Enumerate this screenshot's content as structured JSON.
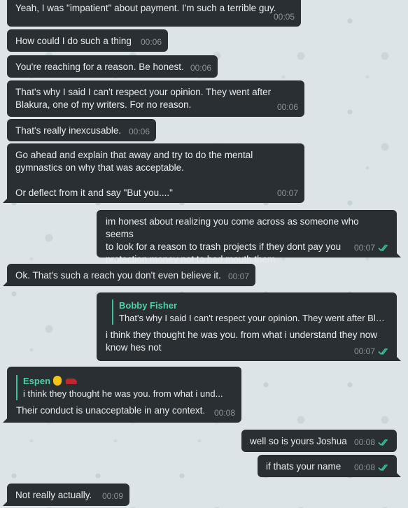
{
  "colors": {
    "bubble": "#2a2f33",
    "text": "#e9edef",
    "time": "#8a949a",
    "quote_accent": "#3fbf9a",
    "read_check": "#3fbf9a"
  },
  "messages": [
    {
      "text": "Yeah, I was \"impatient\" about payment. I'm such a terrible guy.",
      "time": "00:05"
    },
    {
      "text": "How could I do such a thing",
      "time": "00:06"
    },
    {
      "text": "You're reaching for a reason. Be honest.",
      "time": "00:06"
    },
    {
      "text": "That's why I said I can't respect your opinion. They went after\nBlakura, one of my writers. For no reason.",
      "time": "00:06"
    },
    {
      "text": "That's really inexcusable.",
      "time": "00:06"
    },
    {
      "text": "Go ahead and explain that away and try to do the mental\ngymnastics on why that was acceptable.\n\nOr deflect from it and say \"But you....\"",
      "time": "00:07"
    },
    {
      "text": "im honest about realizing you come across as someone who seems\nto look for a reason to trash projects if they dont pay you\nprotection money not to bad mouth them",
      "time": "00:07"
    },
    {
      "text": "Ok. That's such a reach you don't even believe it.",
      "time": "00:07"
    },
    {
      "quote_name": "Bobby Fisher",
      "quote_text": "That's why I said I can't respect your opinion. They went after Bla...",
      "text": "i think they thought he was you. from what i understand they now\nknow hes not",
      "time": "00:07"
    },
    {
      "quote_name": "Espen",
      "quote_text": "i think they thought he was you. from what i und...",
      "text": "Their conduct is unacceptable in any context.",
      "time": "00:08"
    },
    {
      "text": "well so is yours Joshua",
      "time": "00:08"
    },
    {
      "text": "if thats your name",
      "time": "00:08"
    },
    {
      "text": "Not really actually.",
      "time": "00:09"
    }
  ]
}
